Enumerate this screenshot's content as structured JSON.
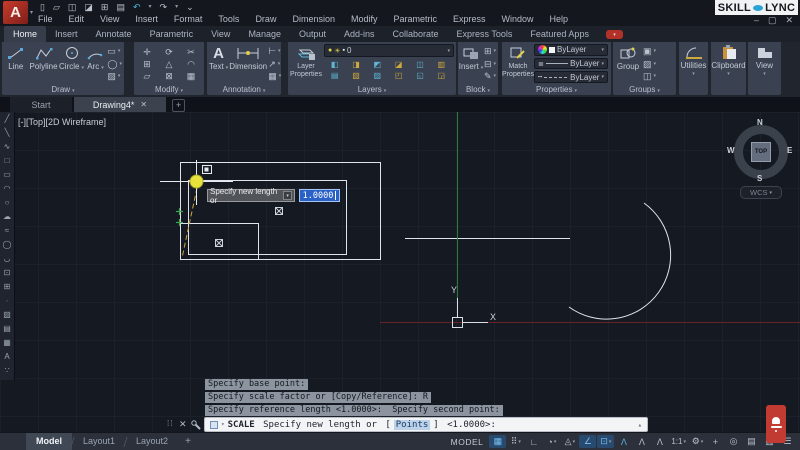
{
  "titlebar": {
    "logo_letter": "A",
    "brand": {
      "left": "SKILL",
      "right": "LYNC"
    },
    "menus": [
      "File",
      "Edit",
      "View",
      "Insert",
      "Format",
      "Tools",
      "Draw",
      "Dimension",
      "Modify",
      "Parametric",
      "Express",
      "Window",
      "Help"
    ],
    "quick_access": [
      {
        "glyph": "▯",
        "name": "qat-new"
      },
      {
        "glyph": "▱",
        "name": "qat-open"
      },
      {
        "glyph": "◫",
        "name": "qat-save"
      },
      {
        "glyph": "◪",
        "name": "qat-save-as"
      },
      {
        "glyph": "⊞",
        "name": "qat-open-from-web"
      },
      {
        "glyph": "▤",
        "name": "qat-plot"
      },
      {
        "glyph": "↶",
        "name": "qat-undo",
        "accent": true
      },
      {
        "glyph": "▾",
        "name": "qat-undo-menu",
        "small": true
      },
      {
        "glyph": "↷",
        "name": "qat-redo"
      },
      {
        "glyph": "▾",
        "name": "qat-redo-menu",
        "small": true
      },
      {
        "glyph": "⌄",
        "name": "qat-customize"
      }
    ],
    "window_controls": [
      {
        "glyph": "–",
        "name": "minimize-button"
      },
      {
        "glyph": "▢",
        "name": "restore-button"
      },
      {
        "glyph": "✕",
        "name": "close-button"
      }
    ]
  },
  "ribbon": {
    "active_tab": "Home",
    "tabs": [
      "Home",
      "Insert",
      "Annotate",
      "Parametric",
      "View",
      "Manage",
      "Output",
      "Add-ins",
      "Collaborate",
      "Express Tools",
      "Featured Apps"
    ],
    "panels": {
      "draw": {
        "label": "Draw",
        "tools": [
          "Line",
          "Polyline",
          "Circle",
          "Arc"
        ],
        "side_tools": [
          {
            "glyph": "▭",
            "name": "rectangle-tool"
          },
          {
            "glyph": "◯",
            "name": "ellipse-tool"
          },
          {
            "glyph": "▨",
            "name": "hatch-tool"
          }
        ]
      },
      "modify": {
        "label": "Modify",
        "tools": [
          {
            "glyph": "✛",
            "name": "move-tool"
          },
          {
            "glyph": "⟳",
            "name": "rotate-tool"
          },
          {
            "glyph": "✂",
            "name": "trim-tool"
          },
          {
            "glyph": "⊞",
            "name": "copy-tool"
          },
          {
            "glyph": "△",
            "name": "mirror-tool"
          },
          {
            "glyph": "◠",
            "name": "fillet-tool"
          },
          {
            "glyph": "▱",
            "name": "stretch-tool"
          },
          {
            "glyph": "⊠",
            "name": "scale-tool"
          },
          {
            "glyph": "▦",
            "name": "array-tool"
          }
        ]
      },
      "annotation": {
        "label": "Annotation",
        "tools": [
          "Text",
          "Dimension"
        ],
        "side_tools": [
          {
            "glyph": "⊢",
            "name": "leader-tool"
          },
          {
            "glyph": "↗",
            "name": "multileader-tool"
          },
          {
            "glyph": "▦",
            "name": "table-tool"
          }
        ]
      },
      "layers": {
        "label": "Layers",
        "big": "Layer Properties",
        "current_layer": "0",
        "combo_icons": [
          {
            "glyph": "●",
            "name": "layer-bulb-icon"
          },
          {
            "glyph": "☀",
            "name": "layer-sun-icon"
          },
          {
            "glyph": "▪",
            "name": "layer-swatch-icon"
          }
        ],
        "grid": [
          "◧",
          "◨",
          "◩",
          "◪",
          "◫",
          "▥",
          "▤",
          "▧",
          "▨",
          "◰",
          "◱",
          "◲"
        ]
      },
      "block": {
        "label": "Block",
        "big": "Insert",
        "side_tools": [
          {
            "glyph": "⊞",
            "name": "create-block-tool"
          },
          {
            "glyph": "⊟",
            "name": "define-attributes-tool"
          },
          {
            "glyph": "✎",
            "name": "block-editor-tool"
          }
        ]
      },
      "properties": {
        "label": "Properties",
        "big": "Match Properties",
        "color": "ByLayer",
        "lineweight": "ByLayer",
        "linetype": "ByLayer"
      },
      "groups": {
        "label": "Groups",
        "big": "Group",
        "side_tools": [
          {
            "glyph": "▣",
            "name": "ungroup-tool"
          },
          {
            "glyph": "▨",
            "name": "group-edit-tool"
          },
          {
            "glyph": "◫",
            "name": "group-selection-tool"
          }
        ]
      },
      "utilities": {
        "label": "Utilities"
      },
      "clipboard": {
        "label": "Clipboard"
      },
      "view": {
        "label": "View"
      }
    }
  },
  "file_tabs": {
    "tabs": [
      {
        "label": "Start",
        "active": false
      },
      {
        "label": "Drawing4*",
        "active": true
      }
    ],
    "new_tab": "+"
  },
  "left_toolbar": [
    {
      "glyph": "╱",
      "name": "line"
    },
    {
      "glyph": "╲",
      "name": "construction-line"
    },
    {
      "glyph": "∿",
      "name": "polyline"
    },
    {
      "glyph": "□",
      "name": "polygon"
    },
    {
      "glyph": "▭",
      "name": "rectangle"
    },
    {
      "glyph": "◠",
      "name": "arc"
    },
    {
      "glyph": "○",
      "name": "circle"
    },
    {
      "glyph": "☁",
      "name": "revision-cloud"
    },
    {
      "glyph": "≈",
      "name": "spline"
    },
    {
      "glyph": "◯",
      "name": "ellipse"
    },
    {
      "glyph": "◡",
      "name": "ellipse-arc"
    },
    {
      "glyph": "⊡",
      "name": "insert-block"
    },
    {
      "glyph": "⊞",
      "name": "create-block"
    },
    {
      "glyph": "∙",
      "name": "point"
    },
    {
      "glyph": "▨",
      "name": "hatch"
    },
    {
      "glyph": "▤",
      "name": "gradient"
    },
    {
      "glyph": "▦",
      "name": "table"
    },
    {
      "glyph": "A",
      "name": "text"
    },
    {
      "glyph": "∵",
      "name": "multiple-points"
    }
  ],
  "viewport": {
    "label": "[-][Top][2D Wireframe]",
    "viewcube": {
      "north": "N",
      "south": "S",
      "east": "E",
      "west": "W",
      "face": "TOP",
      "wcs": "WCS"
    },
    "axis_y_label": "Y",
    "axis_x_label": "X"
  },
  "dyn_input": {
    "prompt": "Specify new length or",
    "value": "1.0000"
  },
  "command": {
    "history": [
      "Specify base point:",
      "Specify scale factor or [Copy/Reference]: R",
      "Specify reference length <1.0000>:  Specify second point:"
    ],
    "line": {
      "command": "SCALE",
      "text": " Specify new length or ",
      "bracket_open": "[",
      "option": "Points",
      "bracket_close": "]",
      "default": " <1.0000>:"
    }
  },
  "statusbar": {
    "layout_tabs": [
      "Model",
      "Layout1",
      "Layout2"
    ],
    "active_layout": "Model",
    "new_layout": "+",
    "space_label": "MODEL",
    "icons": [
      {
        "name": "grid-display",
        "glyph": "▦",
        "active": true
      },
      {
        "name": "snap-mode",
        "glyph": "⠿",
        "caret": true
      },
      {
        "name": "ortho-mode",
        "glyph": "∟"
      },
      {
        "name": "polar-tracking",
        "glyph": "◔",
        "caret": true
      },
      {
        "name": "isometric-drafting",
        "glyph": "◬",
        "caret": true
      },
      {
        "name": "object-snap-tracking",
        "glyph": "∠",
        "active": true
      },
      {
        "name": "object-snap",
        "glyph": "⊡",
        "active": true,
        "caret": true
      },
      {
        "name": "annotation-visibility",
        "glyph": "Λ",
        "accent": true
      },
      {
        "name": "annotation-autoscale",
        "glyph": "Λ"
      },
      {
        "name": "annotation-scale-list",
        "glyph": "Λ"
      },
      {
        "name": "annotation-scale",
        "text": "1:1",
        "caret": true
      },
      {
        "name": "workspace-switching",
        "glyph": "⚙",
        "caret": true
      },
      {
        "name": "crosshair-customize",
        "glyph": "+"
      },
      {
        "name": "isolate-objects",
        "glyph": "◎"
      },
      {
        "name": "hardware-acceleration",
        "glyph": "▤"
      },
      {
        "name": "clean-screen",
        "glyph": "▥"
      },
      {
        "name": "customization-menu",
        "glyph": "☰"
      }
    ]
  },
  "colors": {
    "grip_yellow": "#e7e33b",
    "axis_green": "#2e7a3d",
    "axis_red": "#6b2127",
    "selection_blue": "#2a61c7",
    "brand_blue": "#2ba3d4"
  }
}
